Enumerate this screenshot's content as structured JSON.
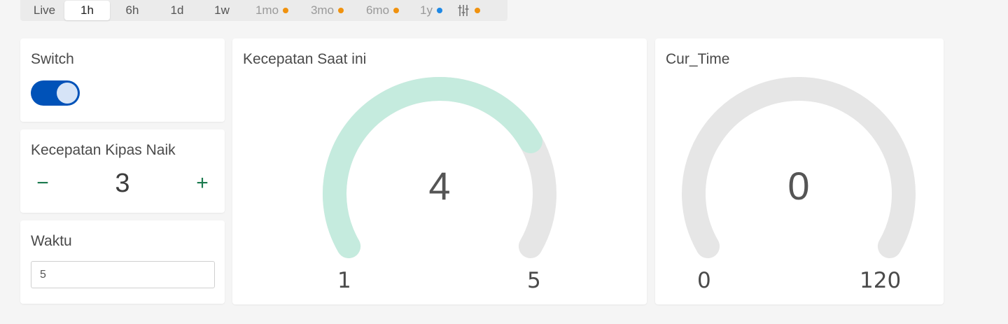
{
  "time_range": {
    "tabs": [
      {
        "label": "Live",
        "active": false,
        "locked": false,
        "dot": null
      },
      {
        "label": "1h",
        "active": true,
        "locked": false,
        "dot": null
      },
      {
        "label": "6h",
        "active": false,
        "locked": false,
        "dot": null
      },
      {
        "label": "1d",
        "active": false,
        "locked": false,
        "dot": null
      },
      {
        "label": "1w",
        "active": false,
        "locked": false,
        "dot": null
      },
      {
        "label": "1mo",
        "active": false,
        "locked": true,
        "dot": "#f0920f"
      },
      {
        "label": "3mo",
        "active": false,
        "locked": true,
        "dot": "#f0920f"
      },
      {
        "label": "6mo",
        "active": false,
        "locked": true,
        "dot": "#f0920f"
      },
      {
        "label": "1y",
        "active": false,
        "locked": true,
        "dot": "#1e88e5"
      }
    ],
    "custom_icon": "sliders-icon",
    "custom_dot": "#f0920f"
  },
  "switch_widget": {
    "title": "Switch",
    "state": "on",
    "on_color": "#0052b8"
  },
  "stepper_widget": {
    "title": "Kecepatan Kipas Naik",
    "value": "3",
    "minus_label": "−",
    "plus_label": "+"
  },
  "input_widget": {
    "title": "Waktu",
    "value": "5"
  },
  "gauge_speed": {
    "title": "Kecepatan Saat ini",
    "value": "4",
    "min": "1",
    "max": "5",
    "fill_fraction": 0.75,
    "fill_color": "#c5ebde",
    "track_color": "#e6e6e6"
  },
  "gauge_time": {
    "title": "Cur_Time",
    "value": "0",
    "min": "0",
    "max": "120",
    "fill_fraction": 0,
    "fill_color": "#c5ebde",
    "track_color": "#e6e6e6"
  }
}
